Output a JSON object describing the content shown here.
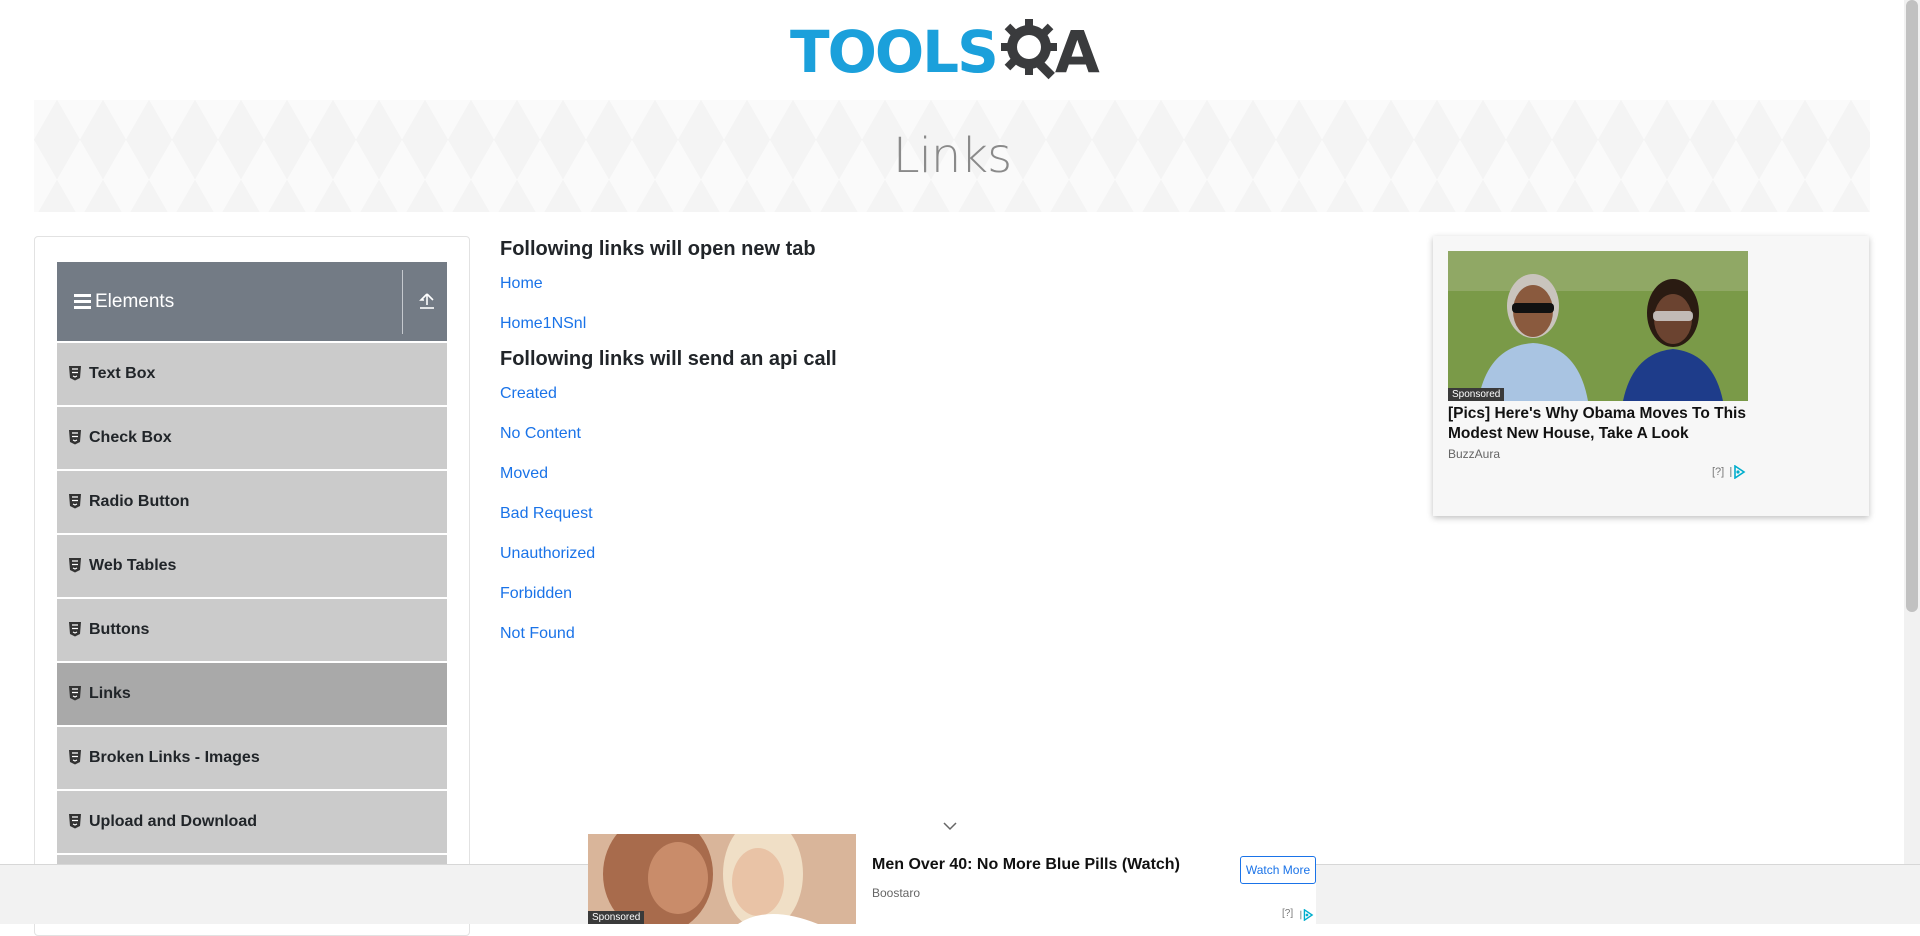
{
  "header": {
    "logo_text": "TOOLS",
    "logo_suffix": "A",
    "logo_accent": "#1ba0db"
  },
  "banner": {
    "title": "Links"
  },
  "sidebar": {
    "group_title": "Elements",
    "items": [
      {
        "label": "Text Box"
      },
      {
        "label": "Check Box"
      },
      {
        "label": "Radio Button"
      },
      {
        "label": "Web Tables"
      },
      {
        "label": "Buttons"
      },
      {
        "label": "Links",
        "active": true
      },
      {
        "label": "Broken Links - Images"
      },
      {
        "label": "Upload and Download"
      }
    ]
  },
  "main": {
    "section1_title": "Following links will open new tab",
    "section1_links": [
      "Home",
      "Home1NSnl"
    ],
    "section2_title": "Following links will send an api call",
    "section2_links": [
      "Created",
      "No Content",
      "Moved",
      "Bad Request",
      "Unauthorized",
      "Forbidden",
      "Not Found"
    ]
  },
  "ad_right": {
    "sponsored": "Sponsored",
    "headline": "[Pics] Here's Why Obama Moves To This Modest New House, Take A Look",
    "source": "BuzzAura",
    "info": "[?]"
  },
  "ad_bottom": {
    "sponsored": "Sponsored",
    "headline": "Men Over 40: No More Blue Pills (Watch)",
    "source": "Boostaro",
    "button": "Watch More",
    "info": "[?]"
  },
  "colors": {
    "link": "#1a73e8",
    "sidebar_header": "#737b85",
    "menu_item": "#cbcbcb",
    "menu_item_active": "#a9a9a9"
  },
  "icons": {
    "menu": "hamburger-icon",
    "collapse": "upload-icon",
    "item": "html5-shield-icon",
    "chevron": "chevron-down-icon",
    "adchoices": "adchoices-icon"
  }
}
